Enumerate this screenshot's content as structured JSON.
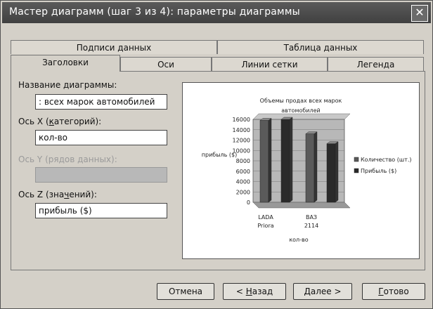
{
  "window": {
    "title": "Мастер диаграмм (шаг 3 из 4): параметры диаграммы",
    "close_label": "✕"
  },
  "tabs_back": [
    "Подписи данных",
    "Таблица данных"
  ],
  "tabs_front": [
    "Заголовки",
    "Оси",
    "Линии сетки",
    "Легенда"
  ],
  "form": {
    "chart_title_label": "Название диаграммы:",
    "chart_title_value": ": всех марок автомобилей",
    "x_axis_label": "Ось X (категорий):",
    "x_axis_value": "кол-во",
    "y_axis_label": "Ось Y (рядов данных):",
    "y_axis_value": "",
    "z_axis_label": "Ось Z (значений):",
    "z_axis_value": "прибыль ($)"
  },
  "chart_data": {
    "type": "bar",
    "title": "Объемы продах всех марок автомобилей",
    "categories": [
      "LADA Priora",
      "ВАЗ 2114"
    ],
    "category_lines": [
      [
        "LADA",
        "Priora"
      ],
      [
        "ВАЗ",
        "2114"
      ]
    ],
    "series": [
      {
        "name": "Количество (шт.)",
        "values": [
          15800,
          13200
        ]
      },
      {
        "name": "Прибыль ($)",
        "values": [
          16000,
          11300
        ]
      }
    ],
    "xlabel": "кол-во",
    "ylabel": "прибыль ($)",
    "ylim": [
      0,
      16000
    ],
    "yticks": [
      0,
      2000,
      4000,
      6000,
      8000,
      10000,
      12000,
      14000,
      16000
    ],
    "legend_position": "right",
    "grid": true
  },
  "buttons": {
    "cancel": "Отмена",
    "back": "< Назад",
    "next": "Далее >",
    "finish": "Готово"
  }
}
